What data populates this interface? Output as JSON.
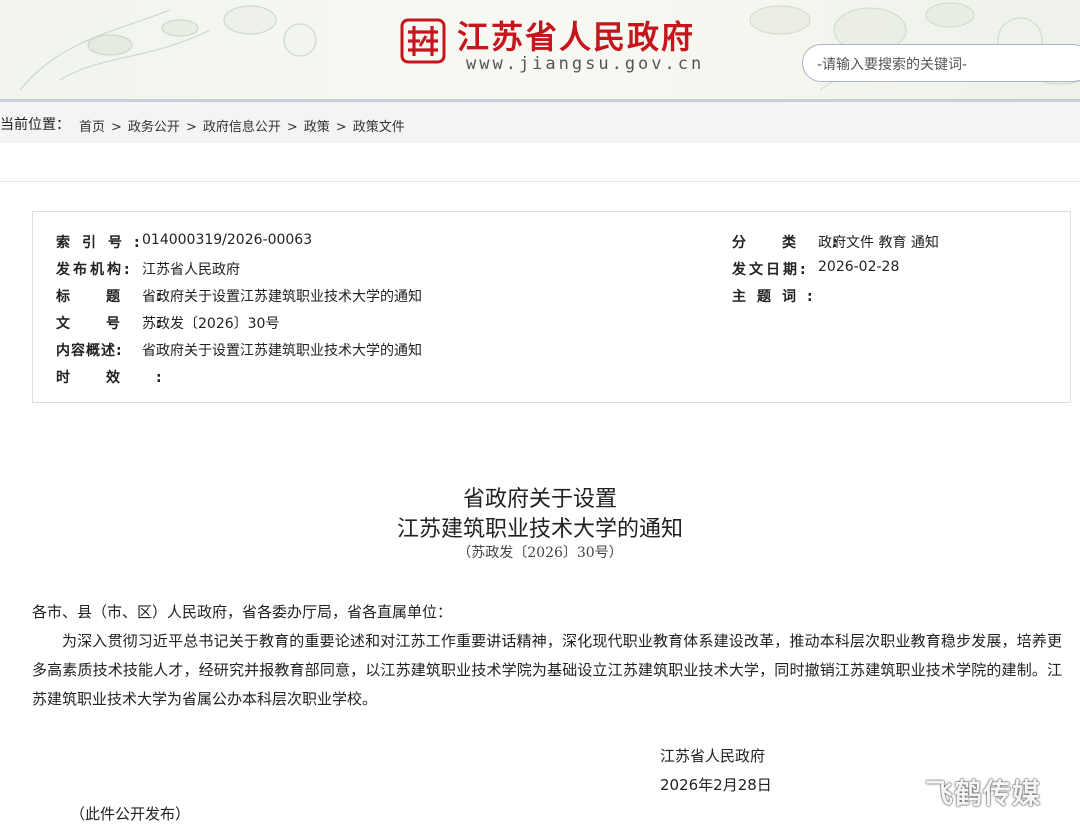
{
  "header": {
    "site_name": "江苏省人民政府",
    "site_url": "www.jiangsu.gov.cn",
    "search_placeholder": "-请输入要搜索的关键词-"
  },
  "breadcrumb": {
    "label": "当前位置：",
    "items": [
      "首页",
      "政务公开",
      "政府信息公开",
      "政策",
      "政策文件"
    ],
    "separator": ">"
  },
  "meta": {
    "index_label": "索引号:",
    "index_value": "014000319/2026-00063",
    "publisher_label": "发布机构:",
    "publisher_value": "江苏省人民政府",
    "title_label": "标题:",
    "title_value": "省政府关于设置江苏建筑职业技术大学的通知",
    "docno_label": "文号:",
    "docno_value": "苏政发〔2026〕30号",
    "summary_label": "内容概述:",
    "summary_value": "省政府关于设置江苏建筑职业技术大学的通知",
    "validity_label": "时效:",
    "validity_value": "",
    "category_label": "分类:",
    "category_value": "政府文件 教育 通知",
    "date_label": "发文日期:",
    "date_value": "2026-02-28",
    "keywords_label": "主题词:",
    "keywords_value": ""
  },
  "document": {
    "title_line1": "省政府关于设置",
    "title_line2": "江苏建筑职业技术大学的通知",
    "doc_number": "（苏政发〔2026〕30号）",
    "salutation": "各市、县（市、区）人民政府，省各委办厅局，省各直属单位：",
    "body": "为深入贯彻习近平总书记关于教育的重要论述和对江苏工作重要讲话精神，深化现代职业教育体系建设改革，推动本科层次职业教育稳步发展，培养更多高素质技术技能人才，经研究并报教育部同意，以江苏建筑职业技术学院为基础设立江苏建筑职业技术大学，同时撤销江苏建筑职业技术学院的建制。江苏建筑职业技术大学为省属公办本科层次职业学校。",
    "signer": "江苏省人民政府",
    "sign_date": "2026年2月28日",
    "publish_note": "（此件公开发布）"
  },
  "watermark": "飞鹤传媒",
  "colors": {
    "brand_red": "#c4161c",
    "header_border": "#c8cfd6",
    "crumb_bg": "#f4f4f4"
  }
}
